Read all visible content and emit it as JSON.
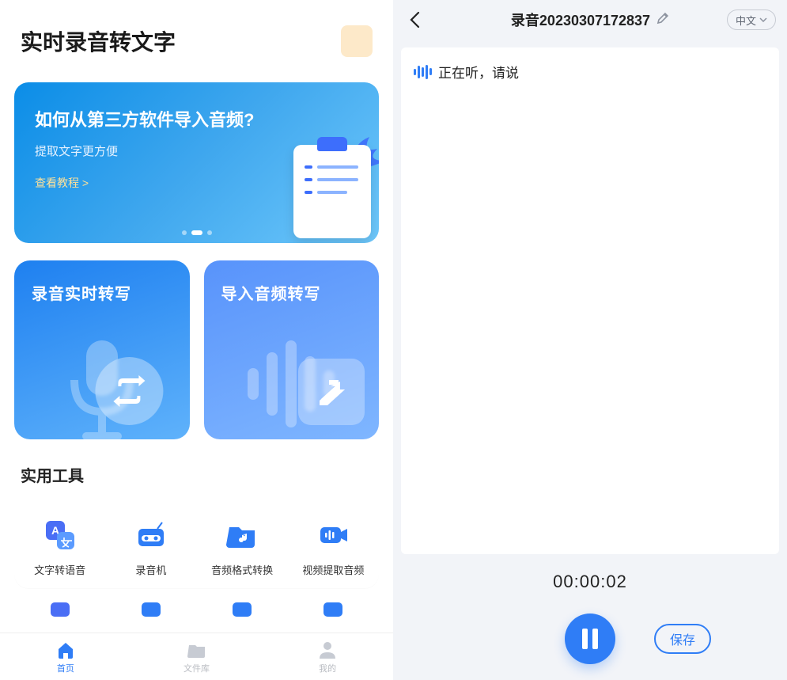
{
  "left": {
    "title": "实时录音转文字",
    "banner": {
      "question": "如何从第三方软件导入音频?",
      "subtitle": "提取文字更方便",
      "link": "查看教程 >"
    },
    "cards": [
      {
        "title": "录音实时转写"
      },
      {
        "title": "导入音频转写"
      }
    ],
    "section_tools": "实用工具",
    "tools": [
      {
        "label": "文字转语音"
      },
      {
        "label": "录音机"
      },
      {
        "label": "音频格式转换"
      },
      {
        "label": "视频提取音频"
      }
    ],
    "nav": [
      {
        "label": "首页"
      },
      {
        "label": "文件库"
      },
      {
        "label": "我的"
      }
    ]
  },
  "right": {
    "title": "录音20230307172837",
    "lang": "中文",
    "listening": "正在听，请说",
    "timer": "00:00:02",
    "save": "保存"
  }
}
